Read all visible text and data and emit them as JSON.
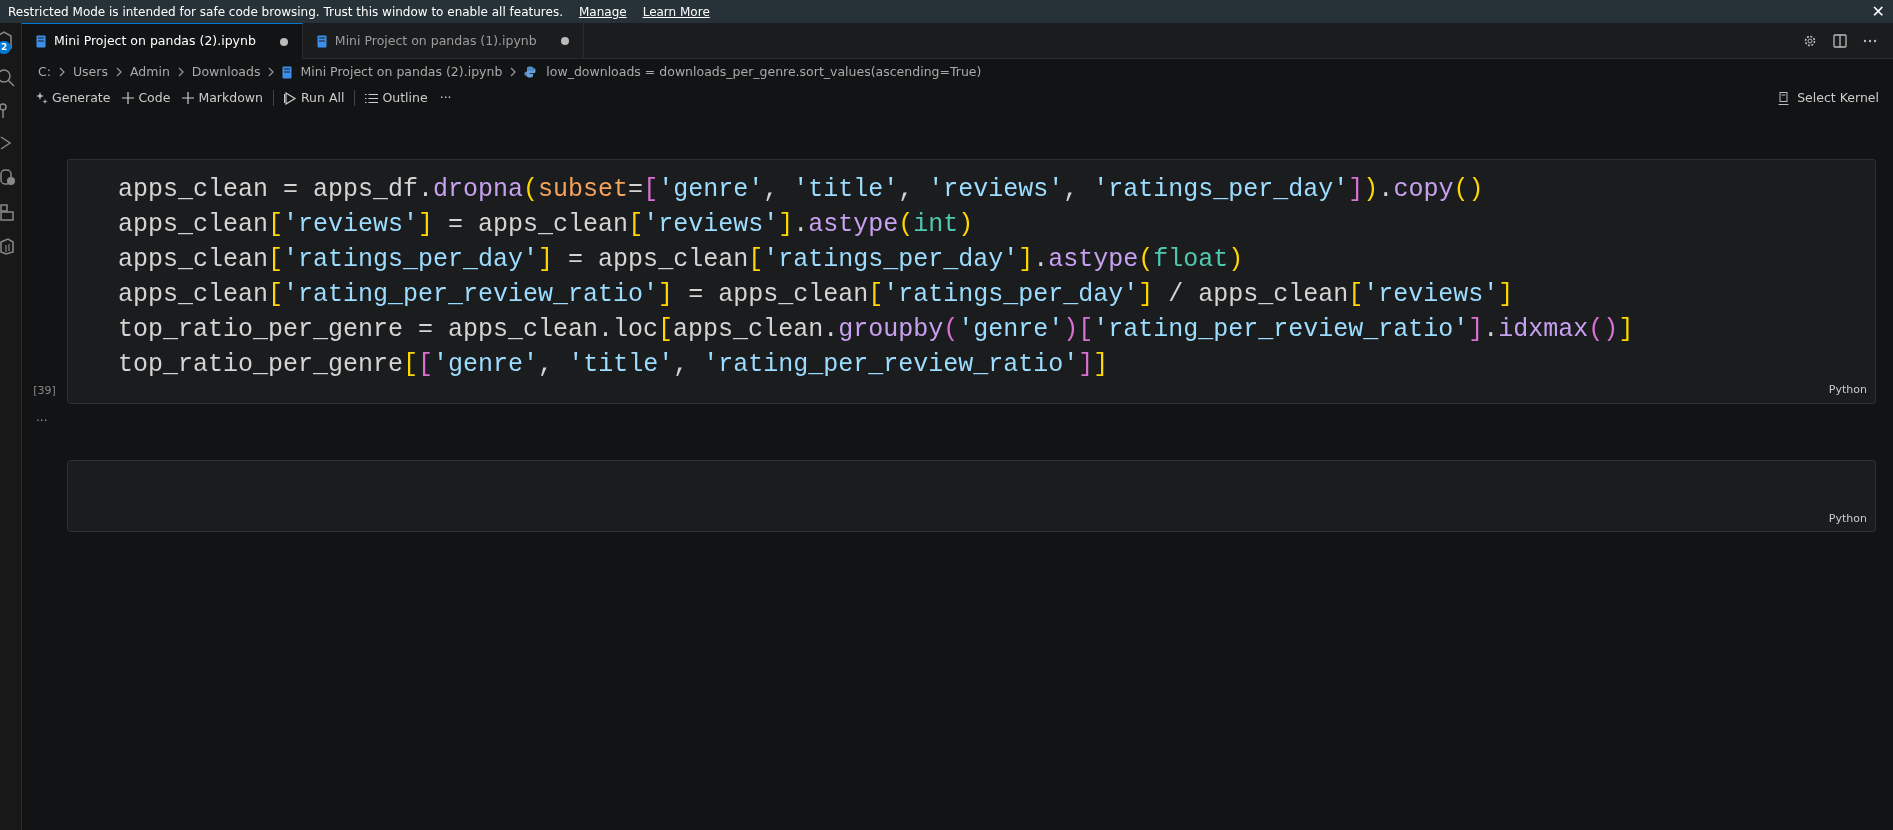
{
  "notification": {
    "text": "Restricted Mode is intended for safe code browsing. Trust this window to enable all features.",
    "links": [
      "Manage",
      "Learn More"
    ],
    "close": "✕"
  },
  "activity_bar": {
    "badge": "2"
  },
  "tabs": [
    {
      "label": "Mini Project on pandas (2).ipynb",
      "selected": true,
      "dirty": true
    },
    {
      "label": "Mini Project on pandas (1).ipynb",
      "selected": false,
      "dirty": true
    }
  ],
  "breadcrumbs": [
    {
      "label": "C:",
      "kind": "folder"
    },
    {
      "label": "Users",
      "kind": "folder"
    },
    {
      "label": "Admin",
      "kind": "folder"
    },
    {
      "label": "Downloads",
      "kind": "folder"
    },
    {
      "label": "Mini Project on pandas (2).ipynb",
      "kind": "notebook"
    },
    {
      "label": "low_downloads = downloads_per_genre.sort_values(ascending=True)",
      "kind": "symbol"
    }
  ],
  "toolbar": [
    {
      "label": "Generate",
      "kind": "generate"
    },
    {
      "label": "Code",
      "kind": "add"
    },
    {
      "label": "Markdown",
      "kind": "add"
    },
    {
      "label": "Run All",
      "kind": "run"
    },
    {
      "label": "Outline",
      "kind": "outline"
    },
    {
      "label": "···",
      "kind": "more"
    }
  ],
  "kernel": {
    "label": "Select Kernel"
  },
  "cells": [
    {
      "execution_count": "[39]",
      "language": "Python",
      "output_more": "...",
      "lines": [
        [
          {
            "text": "apps_clean = apps_df.",
            "kind": "plain"
          },
          {
            "text": "dropna",
            "kind": "fn"
          },
          {
            "text": "(",
            "kind": "b1"
          },
          {
            "text": "subset",
            "kind": "param"
          },
          {
            "text": "=",
            "kind": "plain"
          },
          {
            "text": "[",
            "kind": "b2"
          },
          {
            "text": "'genre'",
            "kind": "str"
          },
          {
            "text": ", ",
            "kind": "plain"
          },
          {
            "text": "'title'",
            "kind": "str"
          },
          {
            "text": ", ",
            "kind": "plain"
          },
          {
            "text": "'reviews'",
            "kind": "str"
          },
          {
            "text": ", ",
            "kind": "plain"
          },
          {
            "text": "'ratings_per_day'",
            "kind": "str"
          },
          {
            "text": "]",
            "kind": "b2"
          },
          {
            "text": ")",
            "kind": "b1"
          },
          {
            "text": ".",
            "kind": "plain"
          },
          {
            "text": "copy",
            "kind": "fn"
          },
          {
            "text": "()",
            "kind": "b1"
          }
        ],
        [
          {
            "text": "apps_clean",
            "kind": "plain"
          },
          {
            "text": "[",
            "kind": "b1"
          },
          {
            "text": "'reviews'",
            "kind": "str"
          },
          {
            "text": "]",
            "kind": "b1"
          },
          {
            "text": " = apps_clean",
            "kind": "plain"
          },
          {
            "text": "[",
            "kind": "b1"
          },
          {
            "text": "'reviews'",
            "kind": "str"
          },
          {
            "text": "]",
            "kind": "b1"
          },
          {
            "text": ".",
            "kind": "plain"
          },
          {
            "text": "astype",
            "kind": "fn"
          },
          {
            "text": "(",
            "kind": "b1"
          },
          {
            "text": "int",
            "kind": "type"
          },
          {
            "text": ")",
            "kind": "b1"
          }
        ],
        [
          {
            "text": "apps_clean",
            "kind": "plain"
          },
          {
            "text": "[",
            "kind": "b1"
          },
          {
            "text": "'ratings_per_day'",
            "kind": "str"
          },
          {
            "text": "]",
            "kind": "b1"
          },
          {
            "text": " = apps_clean",
            "kind": "plain"
          },
          {
            "text": "[",
            "kind": "b1"
          },
          {
            "text": "'ratings_per_day'",
            "kind": "str"
          },
          {
            "text": "]",
            "kind": "b1"
          },
          {
            "text": ".",
            "kind": "plain"
          },
          {
            "text": "astype",
            "kind": "fn"
          },
          {
            "text": "(",
            "kind": "b1"
          },
          {
            "text": "float",
            "kind": "type"
          },
          {
            "text": ")",
            "kind": "b1"
          }
        ],
        [
          {
            "text": "apps_clean",
            "kind": "plain"
          },
          {
            "text": "[",
            "kind": "b1"
          },
          {
            "text": "'rating_per_review_ratio'",
            "kind": "str"
          },
          {
            "text": "]",
            "kind": "b1"
          },
          {
            "text": " = apps_clean",
            "kind": "plain"
          },
          {
            "text": "[",
            "kind": "b1"
          },
          {
            "text": "'ratings_per_day'",
            "kind": "str"
          },
          {
            "text": "]",
            "kind": "b1"
          },
          {
            "text": " / apps_clean",
            "kind": "plain"
          },
          {
            "text": "[",
            "kind": "b1"
          },
          {
            "text": "'reviews'",
            "kind": "str"
          },
          {
            "text": "]",
            "kind": "b1"
          }
        ],
        [
          {
            "text": "top_ratio_per_genre = apps_clean.loc",
            "kind": "plain"
          },
          {
            "text": "[",
            "kind": "b1"
          },
          {
            "text": "apps_clean.",
            "kind": "plain"
          },
          {
            "text": "groupby",
            "kind": "fn"
          },
          {
            "text": "(",
            "kind": "b2"
          },
          {
            "text": "'genre'",
            "kind": "str"
          },
          {
            "text": ")",
            "kind": "b2"
          },
          {
            "text": "[",
            "kind": "b2"
          },
          {
            "text": "'rating_per_review_ratio'",
            "kind": "str"
          },
          {
            "text": "]",
            "kind": "b2"
          },
          {
            "text": ".",
            "kind": "plain"
          },
          {
            "text": "idxmax",
            "kind": "fn"
          },
          {
            "text": "()",
            "kind": "b2"
          },
          {
            "text": "]",
            "kind": "b1"
          }
        ],
        [
          {
            "text": "top_ratio_per_genre",
            "kind": "plain"
          },
          {
            "text": "[",
            "kind": "b1"
          },
          {
            "text": "[",
            "kind": "b2"
          },
          {
            "text": "'genre'",
            "kind": "str"
          },
          {
            "text": ", ",
            "kind": "plain"
          },
          {
            "text": "'title'",
            "kind": "str"
          },
          {
            "text": ", ",
            "kind": "plain"
          },
          {
            "text": "'rating_per_review_ratio'",
            "kind": "str"
          },
          {
            "text": "]",
            "kind": "b2"
          },
          {
            "text": "]",
            "kind": "b1"
          }
        ]
      ]
    },
    {
      "language": "Python"
    }
  ]
}
